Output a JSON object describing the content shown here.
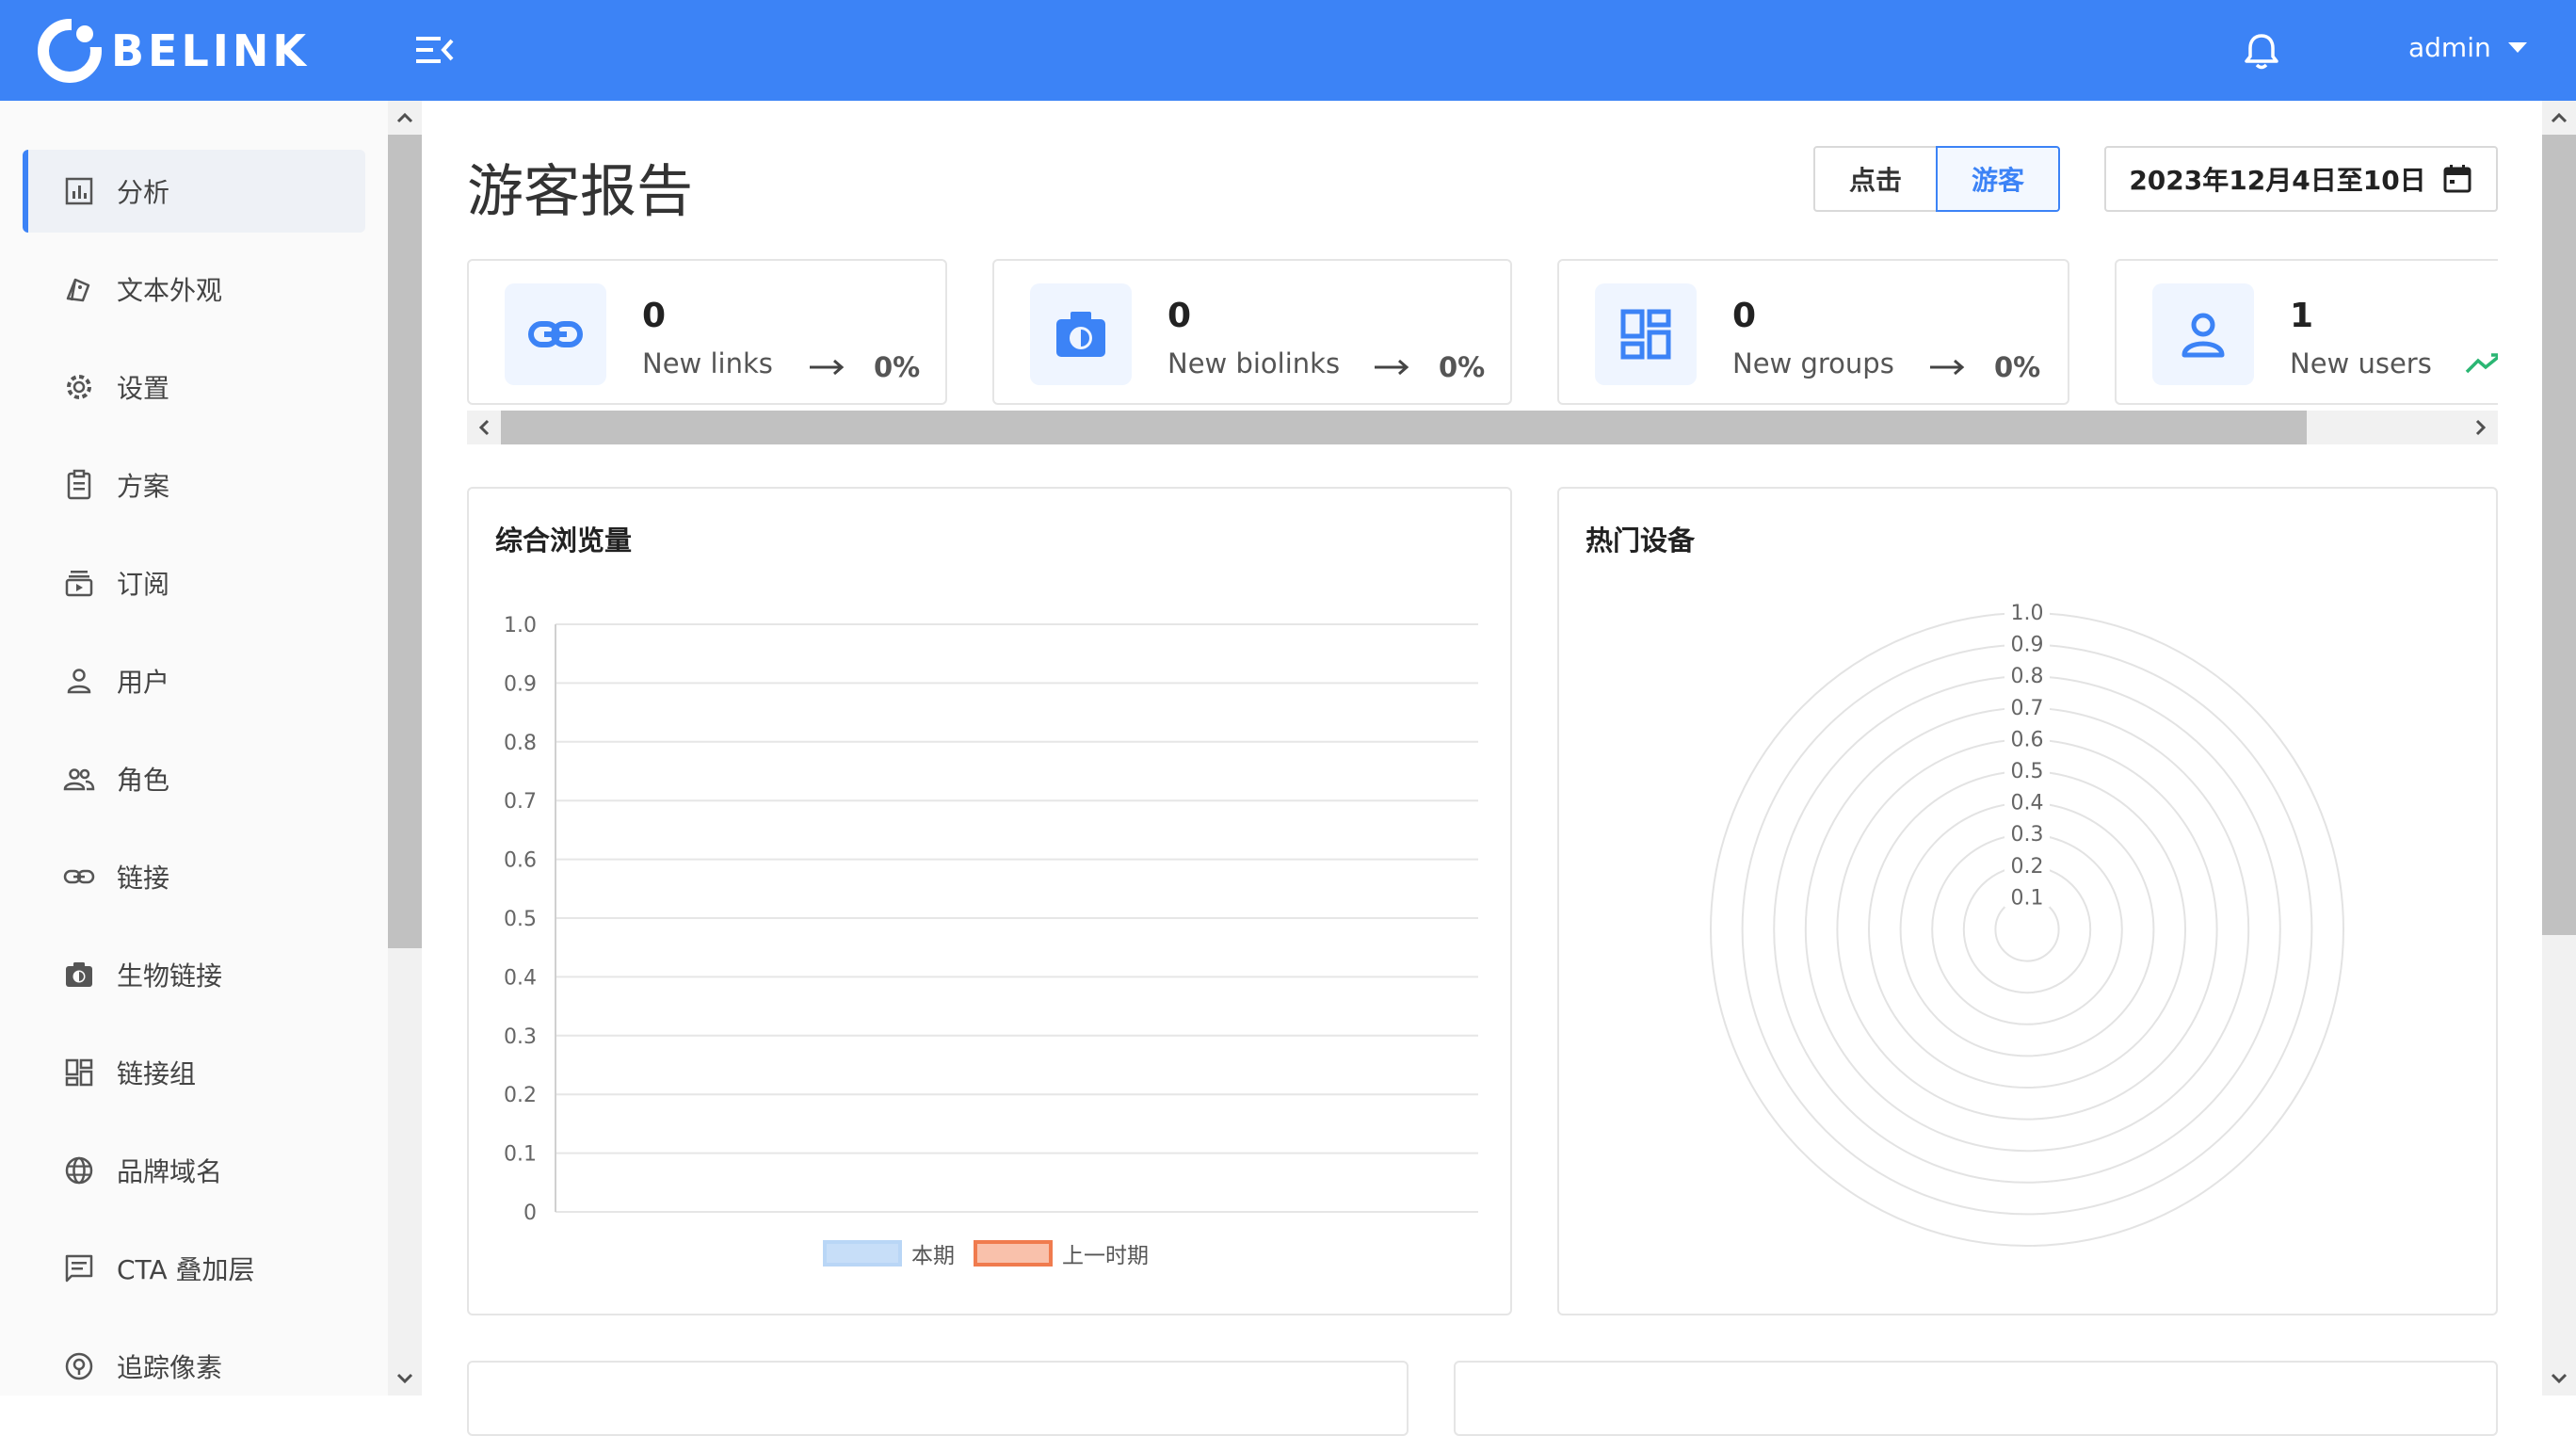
{
  "brand": {
    "name": "BELINK"
  },
  "header": {
    "user": "admin"
  },
  "sidebar": {
    "items": [
      {
        "label": "分析",
        "icon": "analytics-icon",
        "active": true
      },
      {
        "label": "文本外观",
        "icon": "appearance-icon"
      },
      {
        "label": "设置",
        "icon": "gear-icon"
      },
      {
        "label": "方案",
        "icon": "clipboard-icon"
      },
      {
        "label": "订阅",
        "icon": "subscription-icon"
      },
      {
        "label": "用户",
        "icon": "user-icon"
      },
      {
        "label": "角色",
        "icon": "people-icon"
      },
      {
        "label": "链接",
        "icon": "link-icon"
      },
      {
        "label": "生物链接",
        "icon": "camera-icon"
      },
      {
        "label": "链接组",
        "icon": "grid-icon"
      },
      {
        "label": "品牌域名",
        "icon": "globe-icon"
      },
      {
        "label": "CTA 叠加层",
        "icon": "message-icon"
      },
      {
        "label": "追踪像素",
        "icon": "pixel-icon"
      }
    ]
  },
  "main": {
    "title": "游客报告",
    "toggle": {
      "clicks": "点击",
      "visitors": "游客",
      "selected": "visitors"
    },
    "date_range": "2023年12月4日至10日",
    "stats": [
      {
        "value": "0",
        "label": "New links",
        "change": "0%",
        "icon": "link-icon",
        "trend": "flat"
      },
      {
        "value": "0",
        "label": "New biolinks",
        "change": "0%",
        "icon": "camera-icon",
        "trend": "flat"
      },
      {
        "value": "0",
        "label": "New groups",
        "change": "0%",
        "icon": "grid-icon",
        "trend": "flat"
      },
      {
        "value": "1",
        "label": "New users",
        "change": "",
        "icon": "user-icon",
        "trend": "up"
      }
    ],
    "colors": {
      "primary": "#3c83f6",
      "trend_up": "#2bb673",
      "current_period": "#c7def8",
      "previous_period": "#f07b4e"
    }
  },
  "chart_data": [
    {
      "type": "line",
      "title": "综合浏览量",
      "x": [],
      "series": [
        {
          "name": "本期",
          "values": []
        },
        {
          "name": "上一时期",
          "values": []
        }
      ],
      "ylim": [
        0,
        1.0
      ],
      "yticks": [
        "0",
        "0.1",
        "0.2",
        "0.3",
        "0.4",
        "0.5",
        "0.6",
        "0.7",
        "0.8",
        "0.9",
        "1.0"
      ],
      "grid": true,
      "legend": "bottom"
    },
    {
      "type": "polar",
      "title": "热门设备",
      "categories": [],
      "values": [],
      "rlim": [
        0,
        1.0
      ],
      "rticks": [
        "0.1",
        "0.2",
        "0.3",
        "0.4",
        "0.5",
        "0.6",
        "0.7",
        "0.8",
        "0.9",
        "1.0"
      ],
      "grid": true
    }
  ]
}
